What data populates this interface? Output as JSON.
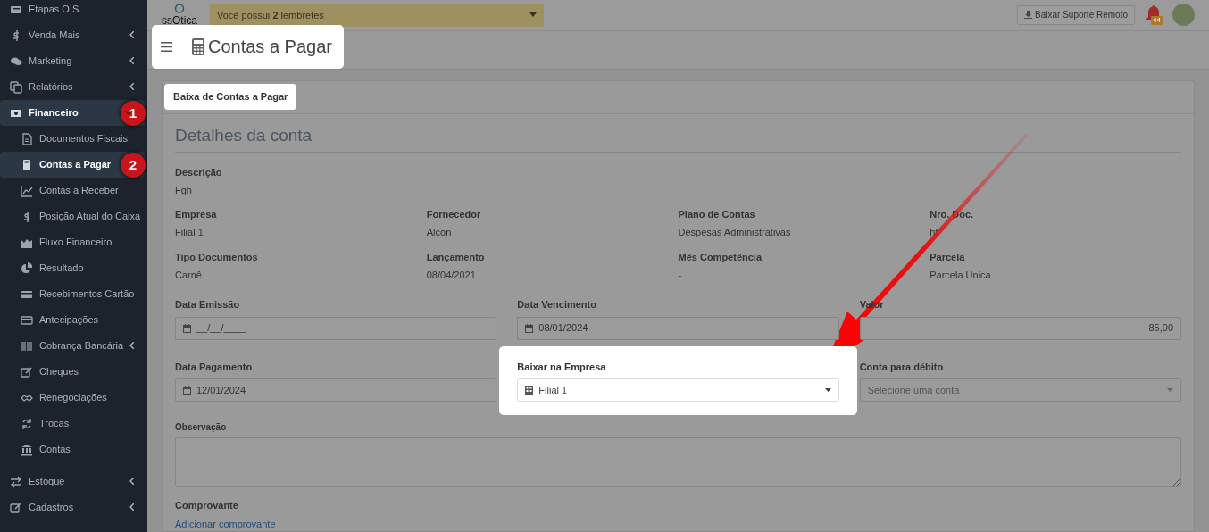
{
  "sidebar": {
    "items": [
      {
        "label": "Etapas O.S.",
        "submenu": false,
        "selected": false
      },
      {
        "label": "Venda Mais",
        "submenu": true,
        "selected": false
      },
      {
        "label": "Marketing",
        "submenu": true,
        "selected": false
      },
      {
        "label": "Relatórios",
        "submenu": true,
        "selected": false
      },
      {
        "label": "Financeiro",
        "submenu": true,
        "selected": true,
        "expanded": true,
        "callout": "1",
        "children": [
          {
            "label": "Documentos Fiscais",
            "selected": false,
            "submenu": false
          },
          {
            "label": "Contas a Pagar",
            "selected": true,
            "submenu": false,
            "callout": "2"
          },
          {
            "label": "Contas a Receber",
            "selected": false,
            "submenu": false
          },
          {
            "label": "Posição Atual do Caixa",
            "selected": false,
            "submenu": false
          },
          {
            "label": "Fluxo Financeiro",
            "selected": false,
            "submenu": false
          },
          {
            "label": "Resultado",
            "selected": false,
            "submenu": false
          },
          {
            "label": "Recebimentos Cartão",
            "selected": false,
            "submenu": false
          },
          {
            "label": "Antecipações",
            "selected": false,
            "submenu": false
          },
          {
            "label": "Cobrança Bancária",
            "selected": false,
            "submenu": true
          },
          {
            "label": "Cheques",
            "selected": false,
            "submenu": false
          },
          {
            "label": "Renegociações",
            "selected": false,
            "submenu": false
          },
          {
            "label": "Trocas",
            "selected": false,
            "submenu": false
          },
          {
            "label": "Contas",
            "selected": false,
            "submenu": false
          }
        ]
      },
      {
        "label": "Estoque",
        "submenu": true,
        "selected": false
      },
      {
        "label": "Cadastros",
        "submenu": true,
        "selected": false
      }
    ]
  },
  "topbar": {
    "logo": "ssOtica",
    "reminder": "Você possui **2** lembretes",
    "support_button": "Baixar Suporte Remoto",
    "notification_count": "44"
  },
  "page_title": "Contas a Pagar",
  "tab": "Baixa de Contas a Pagar",
  "section_title": "Detalhes da conta",
  "description": {
    "label": "Descrição",
    "value": "Fgh"
  },
  "details": [
    {
      "label": "Empresa",
      "value": "Filial 1"
    },
    {
      "label": "Fornecedor",
      "value": "Alcon"
    },
    {
      "label": "Plano de Contas",
      "value": "Despesas Administrativas"
    },
    {
      "label": "Nro. Doc.",
      "value": "hf"
    },
    {
      "label": "Tipo Documentos",
      "value": "Carnê"
    },
    {
      "label": "Lançamento",
      "value": "08/04/2021"
    },
    {
      "label": "Mês Competência",
      "value": "-"
    },
    {
      "label": "Parcela",
      "value": "Parcela Única"
    }
  ],
  "form_rows": [
    [
      {
        "kind": "date",
        "label": "Data Emissão",
        "value": "__/__/____",
        "highlighted": false
      },
      {
        "kind": "date",
        "label": "Data Vencimento",
        "value": "08/01/2024",
        "highlighted": false
      },
      {
        "kind": "money",
        "label": "Valor",
        "value": "85,00",
        "highlighted": false
      }
    ],
    [
      {
        "kind": "date",
        "label": "Data Pagamento",
        "value": "12/01/2024",
        "highlighted": false
      },
      {
        "kind": "select",
        "label": "Baixar na Empresa",
        "value": "Filial 1",
        "highlighted": true
      },
      {
        "kind": "select",
        "label": "Conta para débito",
        "placeholder": "Selecione uma conta",
        "highlighted": false
      }
    ]
  ],
  "observation": {
    "label": "Observação"
  },
  "receipt": {
    "label": "Comprovante",
    "link": "Adicionar comprovante"
  }
}
